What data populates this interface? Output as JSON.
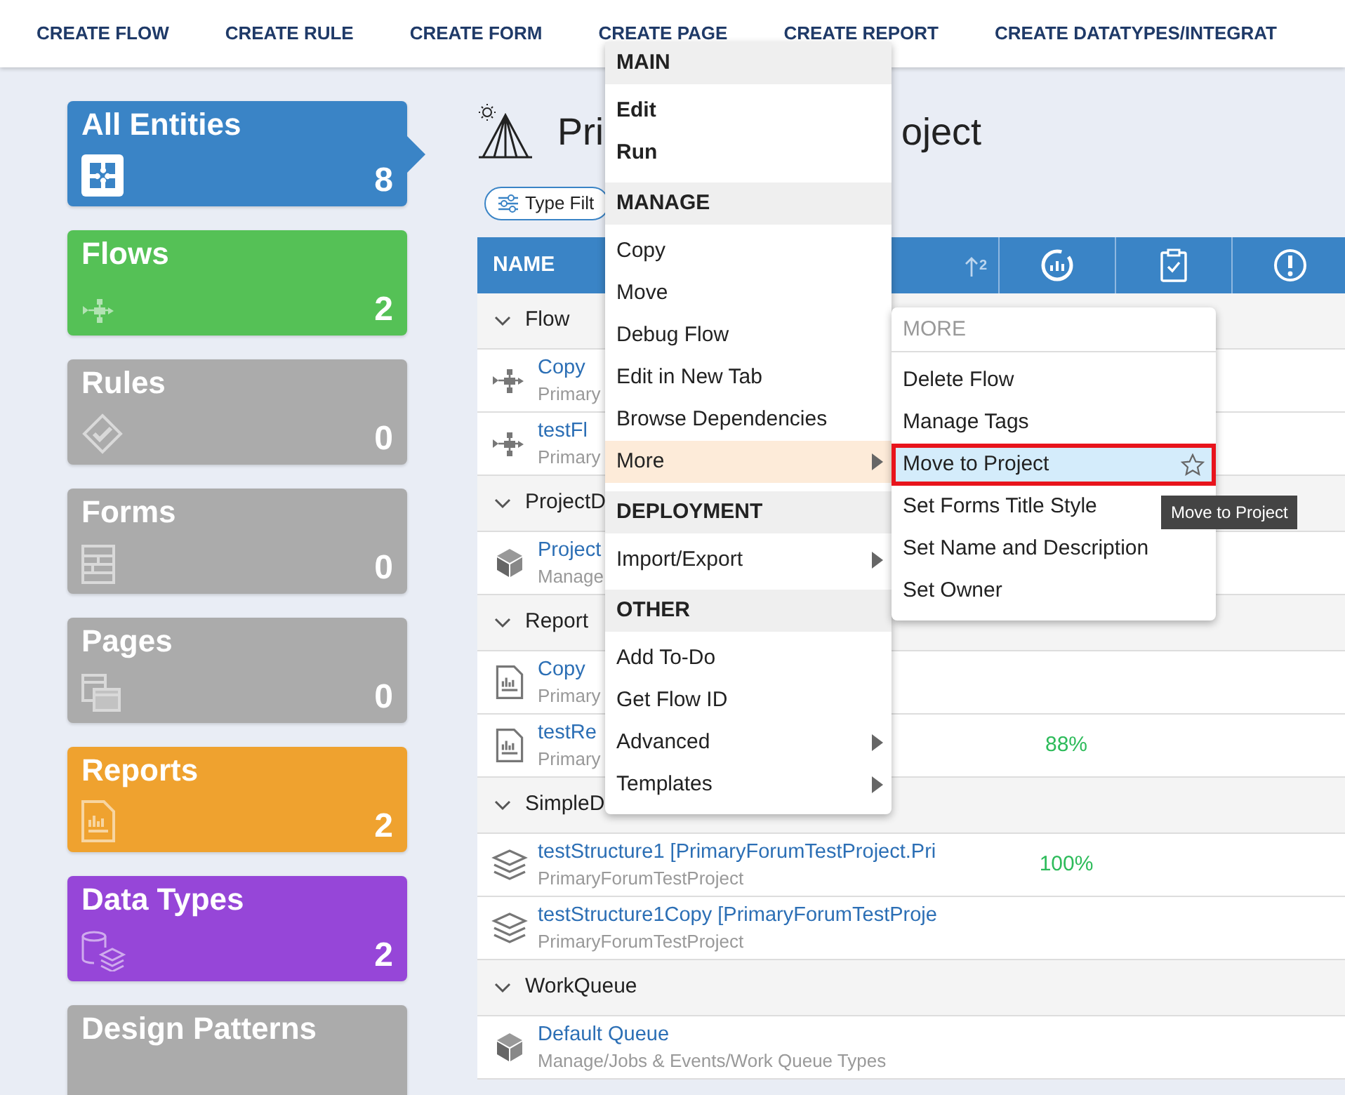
{
  "nav": [
    "CREATE FLOW",
    "CREATE RULE",
    "CREATE FORM",
    "CREATE PAGE",
    "CREATE REPORT",
    "CREATE DATATYPES/INTEGRAT"
  ],
  "sidebar": {
    "tiles": [
      {
        "label": "All Entities",
        "count": "8",
        "color": "#3a84c6",
        "selected": true
      },
      {
        "label": "Flows",
        "count": "2",
        "color": "#55c156",
        "selected": false
      },
      {
        "label": "Rules",
        "count": "0",
        "color": "#ababab",
        "selected": false
      },
      {
        "label": "Forms",
        "count": "0",
        "color": "#ababab",
        "selected": false
      },
      {
        "label": "Pages",
        "count": "0",
        "color": "#ababab",
        "selected": false
      },
      {
        "label": "Reports",
        "count": "2",
        "color": "#efa22f",
        "selected": false
      },
      {
        "label": "Data Types",
        "count": "2",
        "color": "#9646d8",
        "selected": false
      },
      {
        "label": "Design Patterns",
        "color": "#ababab",
        "selected": false
      }
    ]
  },
  "header": {
    "title_start": "Pri",
    "title_end": "oject",
    "filter_button": "Type Filt"
  },
  "table": {
    "columns": [
      {
        "label": "NAME",
        "sort_index": "2"
      }
    ],
    "rows": [
      {
        "kind": "group",
        "label": "Flow",
        "expanded": true
      },
      {
        "kind": "item",
        "name": "Copy",
        "path": "Primary"
      },
      {
        "kind": "item",
        "name": "testFl",
        "path": "Primary"
      },
      {
        "kind": "group",
        "label": "ProjectD",
        "expanded": true
      },
      {
        "kind": "item",
        "name": "Project",
        "path": "Manage"
      },
      {
        "kind": "group",
        "label": "Report",
        "expanded": true
      },
      {
        "kind": "item",
        "name": "Copy",
        "path": "Primary"
      },
      {
        "kind": "item",
        "name": "testRe",
        "path": "Primary",
        "score": "88%"
      },
      {
        "kind": "group",
        "label": "SimpleD",
        "expanded": true
      },
      {
        "kind": "item",
        "name": "testStructure1 [PrimaryForumTestProject.Pri",
        "path": "PrimaryForumTestProject",
        "score": "100%"
      },
      {
        "kind": "item",
        "name": "testStructure1Copy [PrimaryForumTestProje",
        "path": "PrimaryForumTestProject"
      },
      {
        "kind": "group",
        "label": "WorkQueue",
        "expanded": true
      },
      {
        "kind": "item",
        "name": "Default Queue",
        "path": "Manage/Jobs & Events/Work Queue Types"
      }
    ]
  },
  "context_menu": {
    "sections": [
      {
        "header": "MAIN",
        "items": [
          {
            "label": "Edit",
            "kind": "bold",
            "selected": false
          },
          {
            "label": "Run",
            "kind": "bold",
            "selected": false
          }
        ]
      },
      {
        "header": "MANAGE",
        "items": [
          {
            "label": "Copy",
            "kind": "plain",
            "selected": false
          },
          {
            "label": "Move",
            "kind": "plain",
            "selected": false
          },
          {
            "label": "Debug Flow",
            "kind": "plain",
            "selected": false
          },
          {
            "label": "Edit in New Tab",
            "kind": "plain",
            "selected": false
          },
          {
            "label": "Browse Dependencies",
            "kind": "plain",
            "selected": false
          },
          {
            "label": "More",
            "kind": "submenu",
            "selected": true
          }
        ]
      },
      {
        "header": "DEPLOYMENT",
        "items": [
          {
            "label": "Import/Export",
            "kind": "submenu",
            "selected": false
          }
        ]
      },
      {
        "header": "OTHER",
        "items": [
          {
            "label": "Add To-Do",
            "kind": "plain",
            "selected": false
          },
          {
            "label": "Get Flow ID",
            "kind": "plain",
            "selected": false
          },
          {
            "label": "Advanced",
            "kind": "submenu",
            "selected": false
          },
          {
            "label": "Templates",
            "kind": "submenu",
            "selected": false
          }
        ]
      }
    ]
  },
  "submenu": {
    "header": "MORE",
    "items": [
      {
        "label": "Delete Flow",
        "selected": false
      },
      {
        "label": "Manage Tags",
        "selected": false
      },
      {
        "label": "Move to Project",
        "selected": true
      },
      {
        "label": "Set Forms Title Style",
        "selected": false
      },
      {
        "label": "Set Name and Description",
        "selected": false
      },
      {
        "label": "Set Owner",
        "selected": false
      }
    ]
  },
  "tooltip": "Move to Project"
}
